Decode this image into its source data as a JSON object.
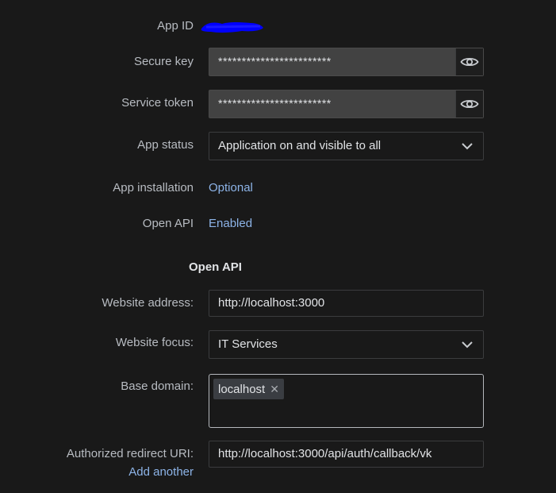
{
  "app_id": {
    "label": "App ID"
  },
  "secure_key": {
    "label": "Secure key",
    "value": "************************"
  },
  "service_token": {
    "label": "Service token",
    "value": "************************"
  },
  "app_status": {
    "label": "App status",
    "value": "Application on and visible to all"
  },
  "app_installation": {
    "label": "App installation",
    "value": "Optional"
  },
  "open_api_row": {
    "label": "Open API",
    "value": "Enabled"
  },
  "open_api_section": {
    "title": "Open API"
  },
  "website_address": {
    "label": "Website address:",
    "value": "http://localhost:3000"
  },
  "website_focus": {
    "label": "Website focus:",
    "value": "IT Services"
  },
  "base_domain": {
    "label": "Base domain:",
    "tags": [
      "localhost"
    ],
    "remove_glyph": "✕"
  },
  "redirect_uri": {
    "label": "Authorized redirect URI:",
    "value": "http://localhost:3000/api/auth/callback/vk",
    "add_another": "Add another"
  },
  "colors": {
    "background": "#191919",
    "link": "#8db4e8",
    "redaction": "#0000ff"
  },
  "icons": {
    "reveal": "eye-icon",
    "dropdown": "chevron-down-icon",
    "remove": "close-icon"
  }
}
